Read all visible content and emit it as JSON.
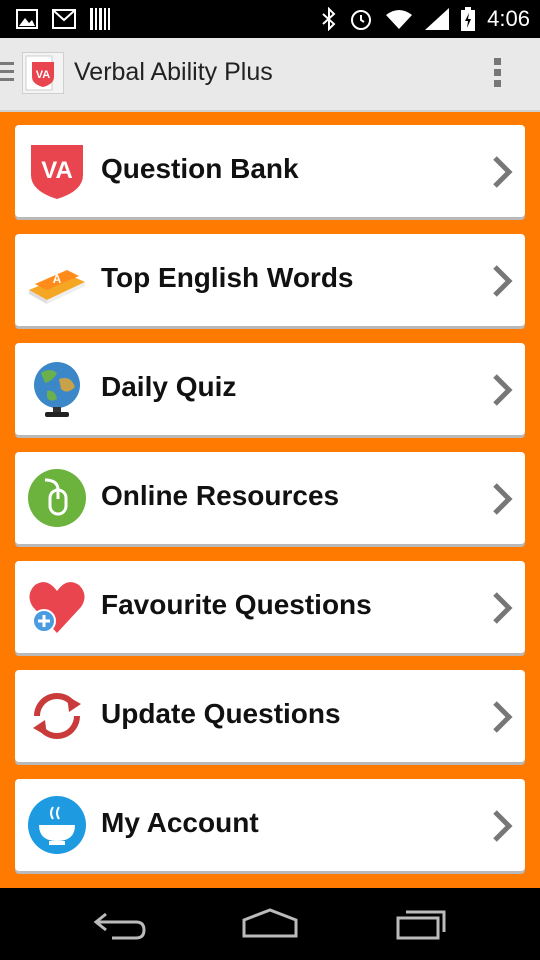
{
  "status_bar": {
    "time": "4:06",
    "left_icons": [
      "image-icon",
      "gmail-icon",
      "barcode-icon"
    ],
    "right_icons": [
      "bluetooth-icon",
      "alarm-icon",
      "wifi-icon",
      "signal-icon",
      "battery-icon"
    ]
  },
  "action_bar": {
    "title": "Verbal Ability Plus",
    "app_icon_text": "VA"
  },
  "menu": {
    "items": [
      {
        "label": "Question Bank",
        "icon": "va-badge-icon"
      },
      {
        "label": "Top English Words",
        "icon": "book-icon"
      },
      {
        "label": "Daily Quiz",
        "icon": "globe-icon"
      },
      {
        "label": "Online Resources",
        "icon": "mouse-icon"
      },
      {
        "label": "Favourite Questions",
        "icon": "heart-plus-icon"
      },
      {
        "label": "Update Questions",
        "icon": "refresh-icon"
      },
      {
        "label": "My Account",
        "icon": "bowl-icon"
      }
    ]
  },
  "colors": {
    "background": "#ff7a00",
    "card": "#ffffff",
    "va_red": "#e8454f"
  },
  "nav_bar": {
    "buttons": [
      "back-icon",
      "home-icon",
      "recents-icon"
    ]
  }
}
